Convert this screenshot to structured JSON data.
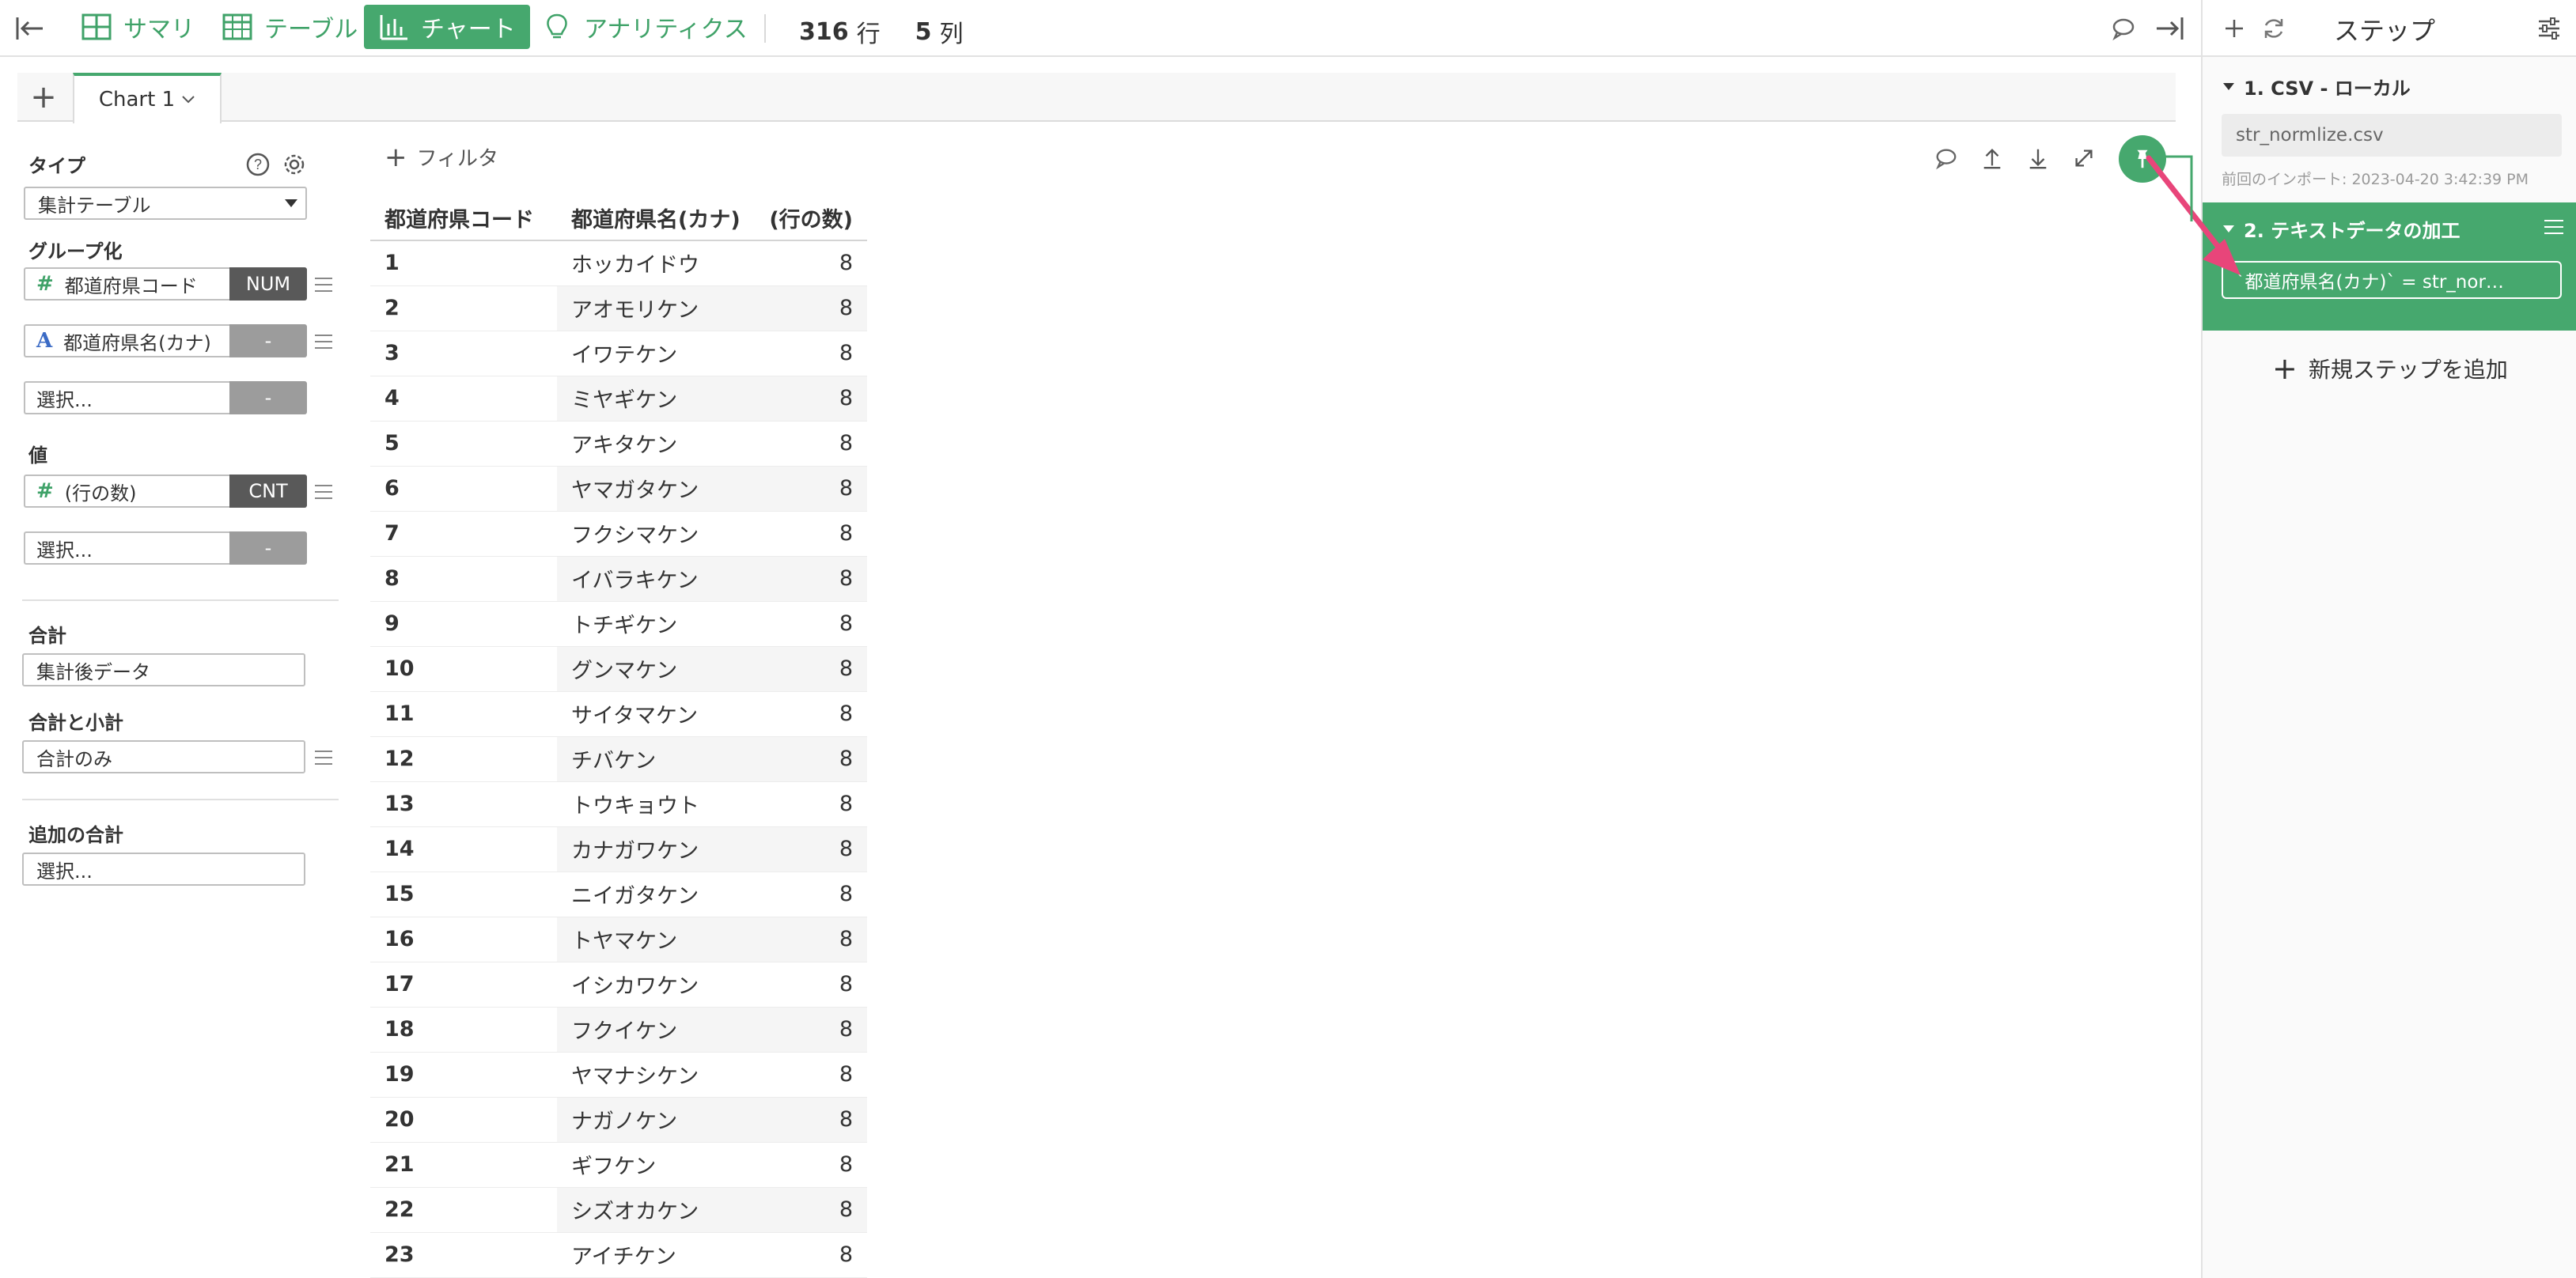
{
  "topbar": {
    "tabs": [
      {
        "label": "サマリ",
        "icon": "summary-grid-icon"
      },
      {
        "label": "テーブル",
        "icon": "table-icon"
      },
      {
        "label": "チャート",
        "icon": "bar-chart-icon",
        "active": true
      },
      {
        "label": "アナリティクス",
        "icon": "lightbulb-icon"
      }
    ],
    "row_count": "316",
    "row_unit": "行",
    "col_count": "5",
    "col_unit": "列"
  },
  "chart_tabs": {
    "add_label": "+",
    "active_tab": "Chart 1"
  },
  "config": {
    "type_label": "タイプ",
    "type_value": "集計テーブル",
    "group_label": "グループ化",
    "groups": [
      {
        "type_symbol": "#",
        "name": "都道府県コード",
        "badge": "NUM"
      },
      {
        "type_symbol": "A",
        "name": "都道府県名(カナ)",
        "badge": "-"
      },
      {
        "type_symbol": "",
        "name": "選択...",
        "badge": "-"
      }
    ],
    "value_label": "値",
    "values": [
      {
        "type_symbol": "#",
        "name": "(行の数)",
        "badge": "CNT"
      },
      {
        "type_symbol": "",
        "name": "選択...",
        "badge": "-"
      }
    ],
    "total_label": "合計",
    "total_value": "集計後データ",
    "subtotal_label": "合計と小計",
    "subtotal_value": "合計のみ",
    "extra_total_label": "追加の合計",
    "extra_total_value": "選択..."
  },
  "table_area": {
    "filter_label": "フィルタ",
    "headers": [
      "都道府県コード",
      "都道府県名(カナ)",
      "(行の数)"
    ],
    "rows": [
      [
        "1",
        "ホッカイドウ",
        "8"
      ],
      [
        "2",
        "アオモリケン",
        "8"
      ],
      [
        "3",
        "イワテケン",
        "8"
      ],
      [
        "4",
        "ミヤギケン",
        "8"
      ],
      [
        "5",
        "アキタケン",
        "8"
      ],
      [
        "6",
        "ヤマガタケン",
        "8"
      ],
      [
        "7",
        "フクシマケン",
        "8"
      ],
      [
        "8",
        "イバラキケン",
        "8"
      ],
      [
        "9",
        "トチギケン",
        "8"
      ],
      [
        "10",
        "グンマケン",
        "8"
      ],
      [
        "11",
        "サイタマケン",
        "8"
      ],
      [
        "12",
        "チバケン",
        "8"
      ],
      [
        "13",
        "トウキョウト",
        "8"
      ],
      [
        "14",
        "カナガワケン",
        "8"
      ],
      [
        "15",
        "ニイガタケン",
        "8"
      ],
      [
        "16",
        "トヤマケン",
        "8"
      ],
      [
        "17",
        "イシカワケン",
        "8"
      ],
      [
        "18",
        "フクイケン",
        "8"
      ],
      [
        "19",
        "ヤマナシケン",
        "8"
      ],
      [
        "20",
        "ナガノケン",
        "8"
      ],
      [
        "21",
        "ギフケン",
        "8"
      ],
      [
        "22",
        "シズオカケン",
        "8"
      ],
      [
        "23",
        "アイチケン",
        "8"
      ]
    ]
  },
  "steps_panel": {
    "title": "ステップ",
    "step1_title": "1. CSV - ローカル",
    "step1_file": "str_normlize.csv",
    "step1_note": "前回のインポート: 2023-04-20 3:42:39 PM",
    "step2_title": "2. テキストデータの加工",
    "step2_expr": "`都道府県名(カナ)` = str_nor…",
    "add_step_label": "新規ステップを追加"
  },
  "colors": {
    "accent_green": "#46a86e",
    "annotation_pink": "#e8457a",
    "badge_dark": "#595959",
    "badge_gray": "#9c9c9c"
  }
}
